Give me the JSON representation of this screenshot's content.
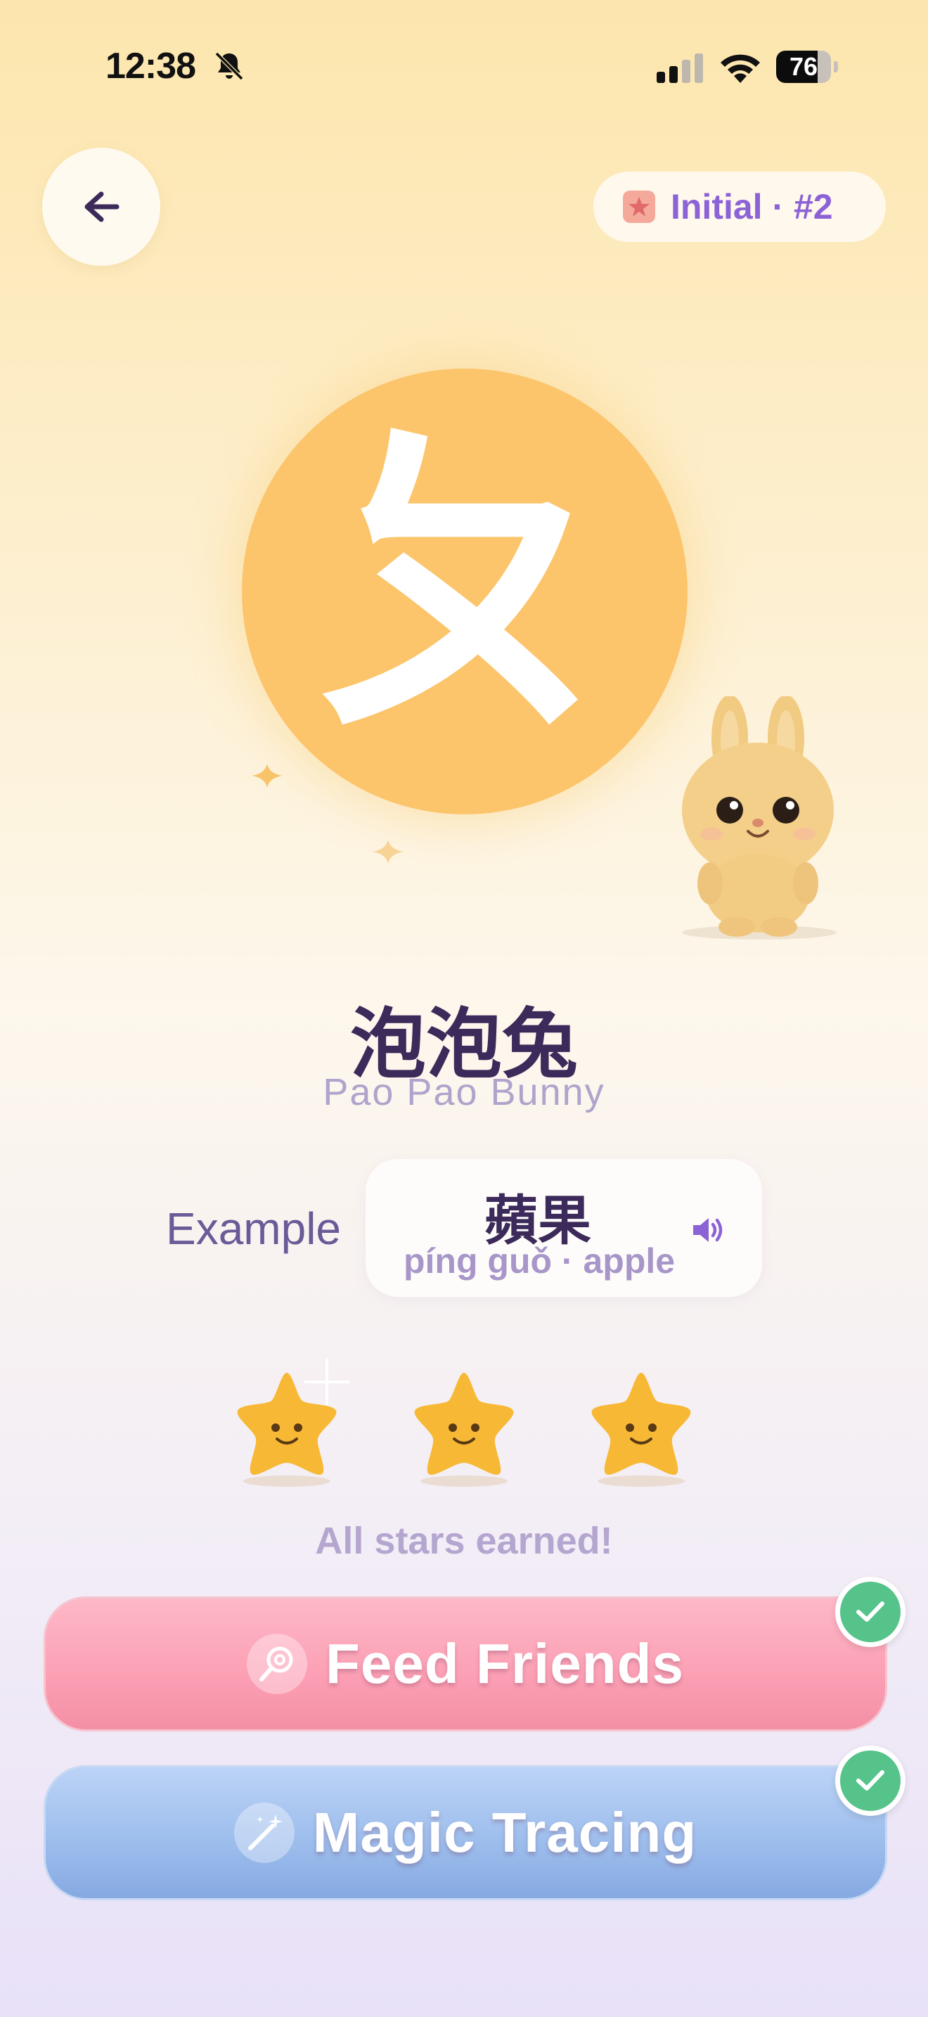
{
  "status_bar": {
    "time": "12:38",
    "battery": "76",
    "battery_level": 0.76
  },
  "header": {
    "back_icon": "arrow-left-icon",
    "badge_icon": "star-tile-icon",
    "badge_text": "Initial · #2"
  },
  "letter": {
    "symbol": "ㄆ",
    "circle_color": "#fcc56c"
  },
  "character": {
    "name": "泡泡兔",
    "romanized": "Pao Pao Bunny"
  },
  "example": {
    "label": "Example",
    "word": "蘋果",
    "pinyin": "píng guǒ · apple",
    "audio_icon": "speaker-icon"
  },
  "stars": {
    "earned": 3,
    "total": 3,
    "status": "All stars earned!"
  },
  "actions": [
    {
      "label": "Feed Friends",
      "icon": "lollipop-icon",
      "completed": true,
      "color": "#fc9fb4"
    },
    {
      "label": "Magic Tracing",
      "icon": "magic-wand-icon",
      "completed": true,
      "color": "#9bbcec"
    }
  ]
}
